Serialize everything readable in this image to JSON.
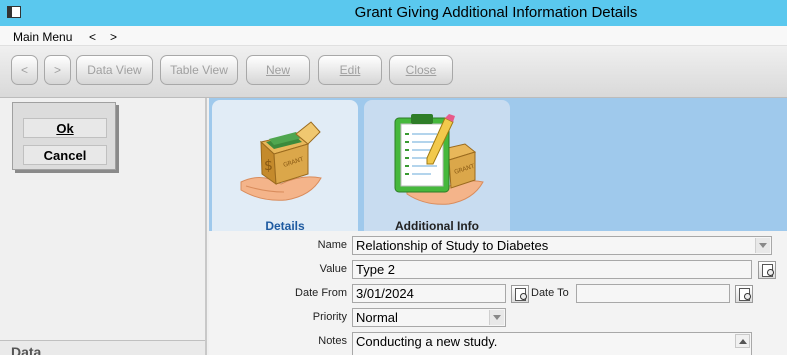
{
  "window": {
    "title": "Grant Giving Additional Information Details"
  },
  "menu": {
    "main_menu": "Main Menu",
    "back": "<",
    "forward": ">"
  },
  "toolbar": {
    "prev": "<",
    "next": ">",
    "data_view": "Data View",
    "table_view": "Table View",
    "new": "New",
    "edit": "Edit",
    "close": "Close"
  },
  "dialog": {
    "ok": "Ok",
    "cancel": "Cancel"
  },
  "left_panel": {
    "section_header": "Data"
  },
  "tabs": [
    {
      "label": "Details",
      "icon": "grant-box-icon",
      "selected": true
    },
    {
      "label": "Additional Info",
      "icon": "clipboard-grant-icon",
      "selected": false
    }
  ],
  "form": {
    "name_label": "Name",
    "name_value": "Relationship of Study to Diabetes",
    "value_label": "Value",
    "value_value": "Type 2",
    "date_from_label": "Date From",
    "date_from_value": "3/01/2024",
    "date_to_label": "Date To",
    "date_to_value": "",
    "priority_label": "Priority",
    "priority_value": "Normal",
    "notes_label": "Notes",
    "notes_value": "Conducting a new study."
  },
  "colors": {
    "titlebar": "#5ac8ee",
    "tab_area": "#9fc9ec",
    "selected_tab_label": "#1e5aa0"
  }
}
